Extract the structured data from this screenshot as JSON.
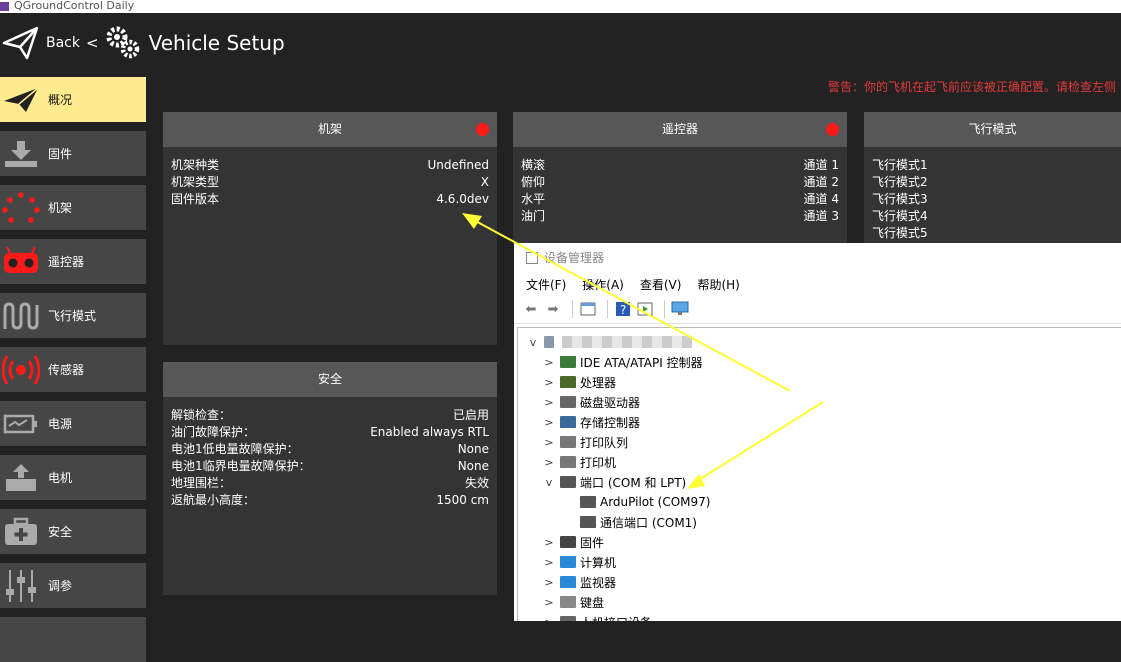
{
  "window": {
    "title": "QGroundControl Daily"
  },
  "header": {
    "back_label": "Back",
    "back_chevron": "<",
    "page_title": "Vehicle Setup"
  },
  "sidebar": {
    "items": [
      {
        "label": "概况",
        "icon": "paper-plane-icon",
        "active": true
      },
      {
        "label": "固件",
        "icon": "download-icon"
      },
      {
        "label": "机架",
        "icon": "airframe-icon"
      },
      {
        "label": "遥控器",
        "icon": "radio-icon"
      },
      {
        "label": "飞行模式",
        "icon": "wave-icon"
      },
      {
        "label": "传感器",
        "icon": "sensor-icon"
      },
      {
        "label": "电源",
        "icon": "battery-icon"
      },
      {
        "label": "电机",
        "icon": "motor-icon"
      },
      {
        "label": "安全",
        "icon": "first-aid-icon"
      },
      {
        "label": "调参",
        "icon": "sliders-icon"
      }
    ]
  },
  "warning": "警告：你的飞机在起飞前应该被正确配置。请检查左侧",
  "cards": {
    "airframe": {
      "title": "机架",
      "rows": [
        {
          "label": "机架种类",
          "value": "Undefined"
        },
        {
          "label": "机架类型",
          "value": "X"
        },
        {
          "label": "固件版本",
          "value": "4.6.0dev"
        }
      ]
    },
    "radio": {
      "title": "遥控器",
      "rows": [
        {
          "label": "横滚",
          "value": "通道 1"
        },
        {
          "label": "俯仰",
          "value": "通道 2"
        },
        {
          "label": "水平",
          "value": "通道 4"
        },
        {
          "label": "油门",
          "value": "通道 3"
        }
      ]
    },
    "flightmodes": {
      "title": "飞行模式",
      "rows": [
        {
          "label": "飞行模式1"
        },
        {
          "label": "飞行模式2"
        },
        {
          "label": "飞行模式3"
        },
        {
          "label": "飞行模式4"
        },
        {
          "label": "飞行模式5"
        }
      ]
    },
    "safety": {
      "title": "安全",
      "rows": [
        {
          "label": "解锁检查：",
          "value": "已启用"
        },
        {
          "label": "油门故障保护：",
          "value": "Enabled always RTL"
        },
        {
          "label": "电池1低电量故障保护：",
          "value": "None"
        },
        {
          "label": "电池1临界电量故障保护：",
          "value": "None"
        },
        {
          "label": "地理围栏：",
          "value": "失效"
        },
        {
          "label": "返航最小高度：",
          "value": "1500 cm"
        }
      ]
    }
  },
  "device_manager": {
    "title": "设备管理器",
    "menu": [
      "文件(F)",
      "操作(A)",
      "查看(V)",
      "帮助(H)"
    ],
    "tree": [
      {
        "label": "IDE ATA/ATAPI 控制器",
        "expander": ">",
        "icon": "ide-icon",
        "color": "#3a7a3a"
      },
      {
        "label": "处理器",
        "expander": ">",
        "icon": "cpu-icon",
        "color": "#4a6a2a"
      },
      {
        "label": "磁盘驱动器",
        "expander": ">",
        "icon": "disk-icon",
        "color": "#666666"
      },
      {
        "label": "存储控制器",
        "expander": ">",
        "icon": "storage-icon",
        "color": "#3a6a9a"
      },
      {
        "label": "打印队列",
        "expander": ">",
        "icon": "printer-icon",
        "color": "#777777"
      },
      {
        "label": "打印机",
        "expander": ">",
        "icon": "printer-icon",
        "color": "#777777"
      },
      {
        "label": "端口 (COM 和 LPT)",
        "expander": "v",
        "icon": "port-icon",
        "color": "#555555"
      },
      {
        "label": "ArduPilot (COM97)",
        "child": true,
        "icon": "port-icon",
        "color": "#555555"
      },
      {
        "label": "通信端口 (COM1)",
        "child": true,
        "icon": "port-icon",
        "color": "#555555"
      },
      {
        "label": "固件",
        "expander": ">",
        "icon": "firmware-icon",
        "color": "#444444"
      },
      {
        "label": "计算机",
        "expander": ">",
        "icon": "computer-icon",
        "color": "#2a8ad8"
      },
      {
        "label": "监视器",
        "expander": ">",
        "icon": "monitor-icon",
        "color": "#2a8ad8"
      },
      {
        "label": "键盘",
        "expander": ">",
        "icon": "keyboard-icon",
        "color": "#888888"
      },
      {
        "label": "人机接口设备",
        "expander": ">",
        "icon": "hid-icon",
        "color": "#666666"
      }
    ]
  },
  "colors": {
    "active": "#ffeb8d",
    "warning": "#e23a3a",
    "status_dot": "#ff1a1a",
    "annotation_arrow": "#ffff33"
  }
}
